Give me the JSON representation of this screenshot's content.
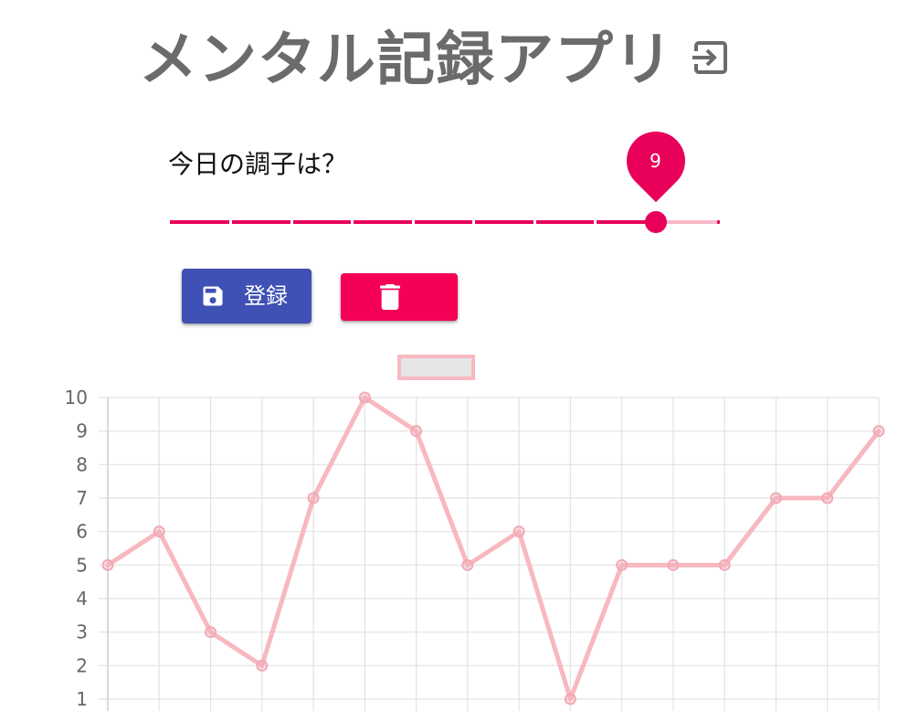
{
  "header": {
    "title": "メンタル記録アプリ",
    "logout_icon": "logout-icon"
  },
  "mood": {
    "question": "今日の調子は？",
    "slider": {
      "value": 9,
      "value_label": "9",
      "min": 1,
      "max": 10,
      "step": 1
    }
  },
  "actions": {
    "save_label": "登録",
    "save_icon": "save-icon",
    "delete_icon": "trash-icon"
  },
  "colors": {
    "accent": "#e8005a",
    "primary_button": "#3f51b5",
    "delete_button": "#f50057",
    "line": "#f8b8c0",
    "title_text": "#6b6b6b"
  },
  "chart_data": {
    "type": "line",
    "title": "",
    "legend": {
      "placement": "top-center",
      "label": ""
    },
    "ylim": [
      1,
      10
    ],
    "y_ticks": [
      "10",
      "9",
      "8",
      "7",
      "6",
      "5",
      "4",
      "3",
      "2",
      "1"
    ],
    "series": [
      {
        "values": [
          5,
          6,
          3,
          2,
          7,
          10,
          9,
          5,
          6,
          1,
          5,
          5,
          5,
          7,
          7,
          9
        ]
      }
    ],
    "grid": true
  }
}
